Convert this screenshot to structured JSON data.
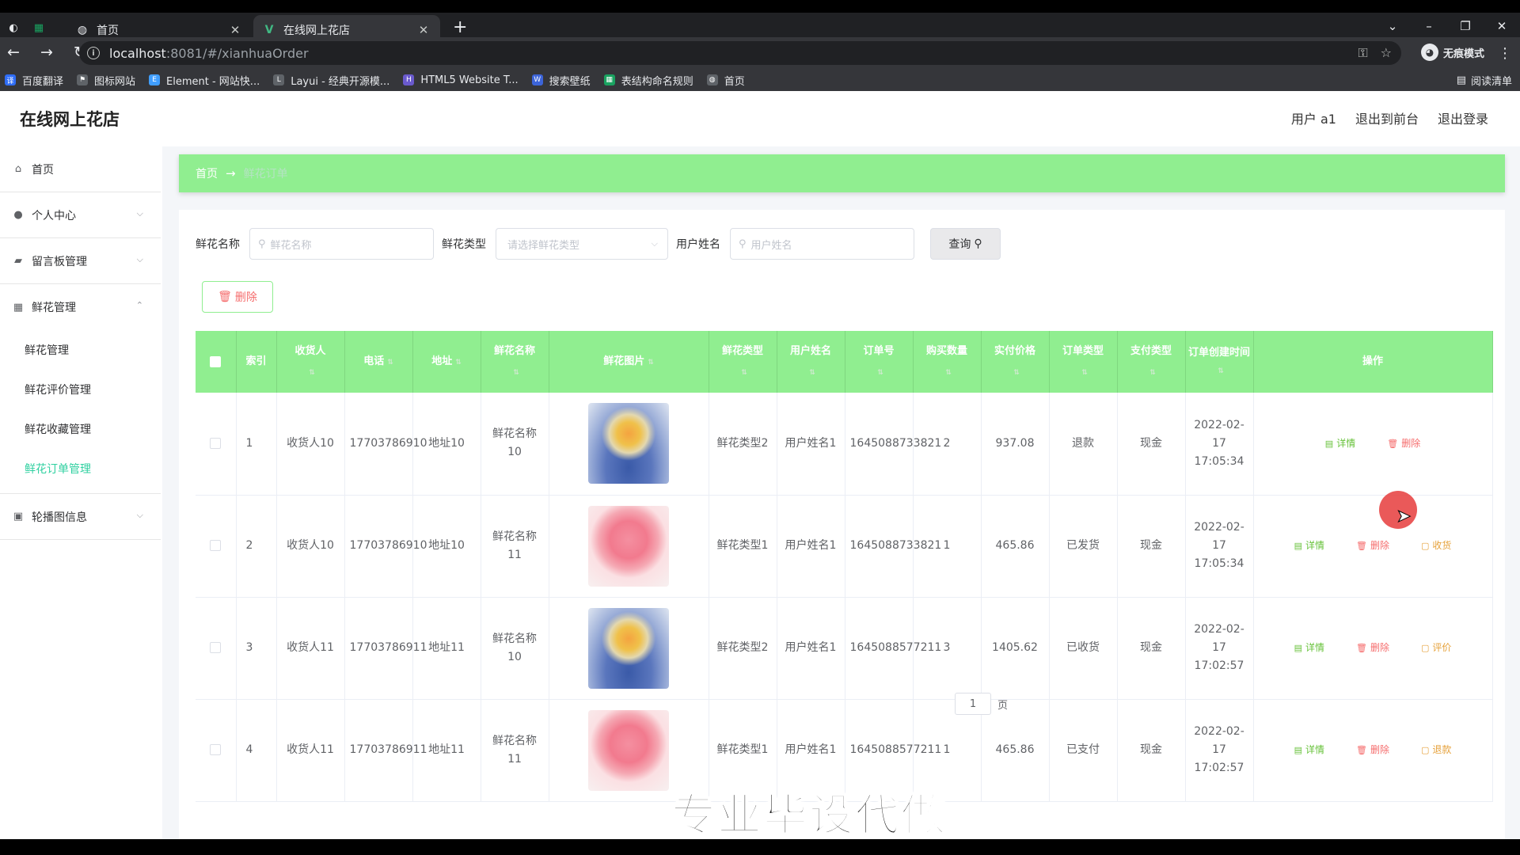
{
  "browser": {
    "tabs": [
      {
        "title": "首页"
      },
      {
        "title": "在线网上花店"
      }
    ],
    "address": {
      "host": "localhost",
      "path": ":8081/#/xianhuaOrder"
    },
    "incognito_label": "无痕模式",
    "bookmarks": [
      {
        "label": "百度翻译",
        "color": "#2f6df6"
      },
      {
        "label": "图标网站",
        "color": "#5f6368"
      },
      {
        "label": "Element - 网站快...",
        "color": "#409eff"
      },
      {
        "label": "Layui - 经典开源模...",
        "color": "#5f6368"
      },
      {
        "label": "HTML5 Website T...",
        "color": "#6a5acd"
      },
      {
        "label": "搜索壁纸",
        "color": "#3c64d8"
      },
      {
        "label": "表结构命名规则",
        "color": "#1aa260"
      },
      {
        "label": "首页",
        "color": "#5f6368"
      }
    ],
    "reading_list": "阅读清单"
  },
  "header": {
    "logo": "在线网上花店",
    "user": "用户 a1",
    "front": "退出到前台",
    "logout": "退出登录"
  },
  "sidebar": {
    "home": "首页",
    "personal": "个人中心",
    "messages": "留言板管理",
    "flowers": "鲜花管理",
    "flower_sub": [
      {
        "label": "鲜花管理",
        "active": false
      },
      {
        "label": "鲜花评价管理",
        "active": false
      },
      {
        "label": "鲜花收藏管理",
        "active": false
      },
      {
        "label": "鲜花订单管理",
        "active": true
      }
    ],
    "carousel": "轮播图信息"
  },
  "breadcrumb": {
    "home": "首页",
    "arrow": "→",
    "current": "鲜花订单"
  },
  "filters": {
    "name_label": "鲜花名称",
    "name_placeholder": "鲜花名称",
    "type_label": "鲜花类型",
    "type_placeholder": "请选择鲜花类型",
    "user_label": "用户姓名",
    "user_placeholder": "用户姓名",
    "query_label": "查询"
  },
  "delete_button": "删除",
  "table": {
    "headers": [
      "索引",
      "收货人",
      "电话",
      "地址",
      "鲜花名称",
      "鲜花图片",
      "鲜花类型",
      "用户姓名",
      "订单号",
      "购买数量",
      "实付价格",
      "订单类型",
      "支付类型",
      "订单创建时间",
      "操作"
    ],
    "rows": [
      {
        "index": "1",
        "receiver": "收货人10",
        "phone": "17703786910",
        "address": "地址10",
        "flower_name": "鲜花名称10",
        "image": "bouquet-blue",
        "flower_type": "鲜花类型2",
        "user_name": "用户姓名1",
        "order_no": "1645088733821",
        "qty": "2",
        "price": "937.08",
        "order_type": "退款",
        "pay_type": "现金",
        "created": "2022-02-17 17:05:34",
        "ops": [
          {
            "label": "详情",
            "kind": "detail"
          },
          {
            "label": "删除",
            "kind": "del"
          }
        ]
      },
      {
        "index": "2",
        "receiver": "收货人10",
        "phone": "17703786910",
        "address": "地址10",
        "flower_name": "鲜花名称11",
        "image": "bouquet-pink",
        "flower_type": "鲜花类型1",
        "user_name": "用户姓名1",
        "order_no": "1645088733821",
        "qty": "1",
        "price": "465.86",
        "order_type": "已发货",
        "pay_type": "现金",
        "created": "2022-02-17 17:05:34",
        "ops": [
          {
            "label": "详情",
            "kind": "detail"
          },
          {
            "label": "删除",
            "kind": "del"
          },
          {
            "label": "收货",
            "kind": "warn"
          }
        ]
      },
      {
        "index": "3",
        "receiver": "收货人11",
        "phone": "17703786911",
        "address": "地址11",
        "flower_name": "鲜花名称10",
        "image": "bouquet-blue",
        "flower_type": "鲜花类型2",
        "user_name": "用户姓名1",
        "order_no": "1645088577211",
        "qty": "3",
        "price": "1405.62",
        "order_type": "已收货",
        "pay_type": "现金",
        "created": "2022-02-17 17:02:57",
        "ops": [
          {
            "label": "详情",
            "kind": "detail"
          },
          {
            "label": "删除",
            "kind": "del"
          },
          {
            "label": "评价",
            "kind": "warn"
          }
        ]
      },
      {
        "index": "4",
        "receiver": "收货人11",
        "phone": "17703786911",
        "address": "地址11",
        "flower_name": "鲜花名称11",
        "image": "bouquet-pink",
        "flower_type": "鲜花类型1",
        "user_name": "用户姓名1",
        "order_no": "1645088577211",
        "qty": "1",
        "price": "465.86",
        "order_type": "已支付",
        "pay_type": "现金",
        "created": "2022-02-17 17:02:57",
        "ops": [
          {
            "label": "详情",
            "kind": "detail"
          },
          {
            "label": "删除",
            "kind": "del"
          },
          {
            "label": "退款",
            "kind": "warn"
          }
        ]
      }
    ]
  },
  "pager": {
    "page": "1",
    "suffix": "页"
  },
  "overlay_caption": "专业毕设代做"
}
